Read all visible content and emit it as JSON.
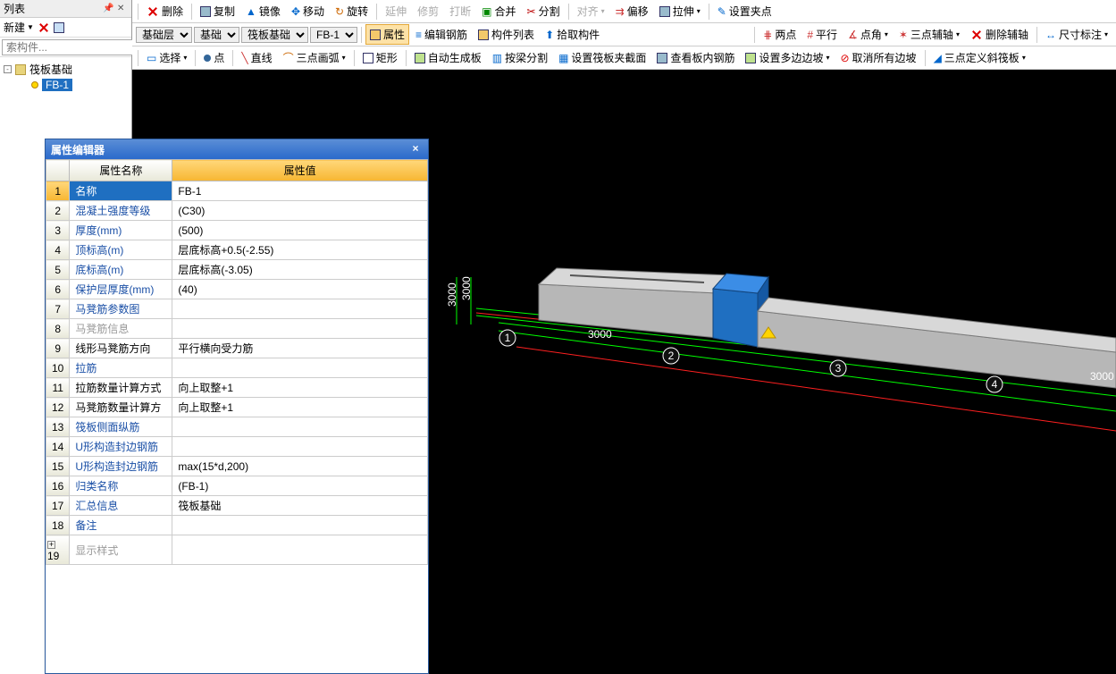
{
  "left_pane": {
    "title": "列表",
    "new_label": "新建",
    "search_placeholder": "索构件...",
    "tree_root": "筏板基础",
    "tree_child": "FB-1"
  },
  "toolbar1": {
    "delete": "删除",
    "copy": "复制",
    "mirror": "镜像",
    "move": "移动",
    "rotate": "旋转",
    "extend": "延伸",
    "trim": "修剪",
    "break": "打断",
    "merge": "合并",
    "split": "分割",
    "align": "对齐",
    "offset": "偏移",
    "stretch": "拉伸",
    "set_clip": "设置夹点"
  },
  "toolbar2": {
    "layer_combo": "基础层",
    "cat_combo": "基础",
    "type_combo": "筏板基础",
    "name_combo": "FB-1",
    "props": "属性",
    "edit_rebar": "编辑钢筋",
    "comp_list": "构件列表",
    "pick_comp": "拾取构件",
    "two_point": "两点",
    "parallel": "平行",
    "angle": "点角",
    "three_point_aux": "三点辅轴",
    "del_aux": "删除辅轴",
    "dim": "尺寸标注"
  },
  "toolbar3": {
    "select": "选择",
    "point": "点",
    "line": "直线",
    "arc": "三点画弧",
    "rect": "矩形",
    "auto_plate": "自动生成板",
    "split_by_beam": "按梁分割",
    "set_clip_section": "设置筏板夹截面",
    "view_rebar": "查看板内钢筋",
    "multi_slope": "设置多边边坡",
    "cancel_slope": "取消所有边坡",
    "three_point_slope": "三点定义斜筏板"
  },
  "viewport": {
    "dim_3000_v": "3000",
    "dim_3000_h": "3000",
    "dim_3000_r": "3000",
    "axis_1": "1",
    "axis_2": "2",
    "axis_3": "3",
    "axis_4": "4"
  },
  "prop_editor": {
    "title": "属性编辑器",
    "col_name": "属性名称",
    "col_value": "属性值",
    "rows": [
      {
        "n": "1",
        "name": "名称",
        "value": "FB-1",
        "sel": true
      },
      {
        "n": "2",
        "name": "混凝土强度等级",
        "value": "(C30)",
        "link": true
      },
      {
        "n": "3",
        "name": "厚度(mm)",
        "value": "(500)",
        "link": true
      },
      {
        "n": "4",
        "name": "顶标高(m)",
        "value": "层底标高+0.5(-2.55)",
        "link": true
      },
      {
        "n": "5",
        "name": "底标高(m)",
        "value": "层底标高(-3.05)",
        "link": true
      },
      {
        "n": "6",
        "name": "保护层厚度(mm)",
        "value": "(40)",
        "link": true
      },
      {
        "n": "7",
        "name": "马凳筋参数图",
        "value": "",
        "link": true
      },
      {
        "n": "8",
        "name": "马凳筋信息",
        "value": "",
        "gray": true
      },
      {
        "n": "9",
        "name": "线形马凳筋方向",
        "value": "平行横向受力筋"
      },
      {
        "n": "10",
        "name": "拉筋",
        "value": "",
        "link": true
      },
      {
        "n": "11",
        "name": "拉筋数量计算方式",
        "value": "向上取整+1"
      },
      {
        "n": "12",
        "name": "马凳筋数量计算方",
        "value": "向上取整+1"
      },
      {
        "n": "13",
        "name": "筏板侧面纵筋",
        "value": "",
        "link": true
      },
      {
        "n": "14",
        "name": "U形构造封边钢筋",
        "value": "",
        "link": true
      },
      {
        "n": "15",
        "name": "U形构造封边钢筋",
        "value": "max(15*d,200)",
        "link": true
      },
      {
        "n": "16",
        "name": "归类名称",
        "value": "(FB-1)",
        "link": true
      },
      {
        "n": "17",
        "name": "汇总信息",
        "value": "筏板基础",
        "link": true
      },
      {
        "n": "18",
        "name": "备注",
        "value": "",
        "link": true
      },
      {
        "n": "19",
        "name": "显示样式",
        "value": "",
        "gray": true,
        "expander": true
      }
    ]
  }
}
